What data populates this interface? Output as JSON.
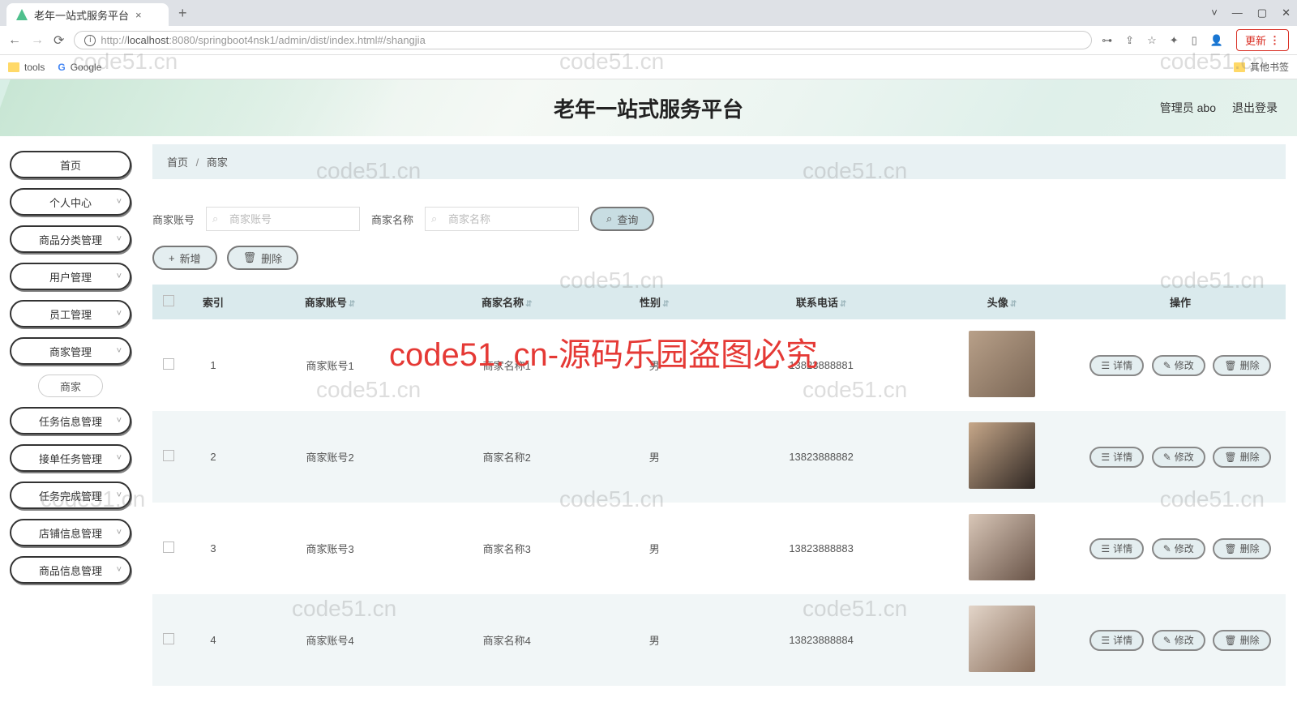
{
  "browser": {
    "tab_title": "老年一站式服务平台",
    "url_prefix": "http://",
    "url_host": "localhost",
    "url_port": ":8080",
    "url_path": "/springboot4nsk1/admin/dist/index.html#/shangjia",
    "update_label": "更新",
    "bookmarks": {
      "tools": "tools",
      "google": "Google",
      "other": "其他书签"
    }
  },
  "banner": {
    "title": "老年一站式服务平台",
    "admin_label": "管理员 abo",
    "logout": "退出登录"
  },
  "sidebar": {
    "items": [
      {
        "label": "首页",
        "expandable": false
      },
      {
        "label": "个人中心",
        "expandable": true
      },
      {
        "label": "商品分类管理",
        "expandable": true
      },
      {
        "label": "用户管理",
        "expandable": true
      },
      {
        "label": "员工管理",
        "expandable": true
      },
      {
        "label": "商家管理",
        "expandable": true
      },
      {
        "label": "商家",
        "sub": true
      },
      {
        "label": "任务信息管理",
        "expandable": true
      },
      {
        "label": "接单任务管理",
        "expandable": true
      },
      {
        "label": "任务完成管理",
        "expandable": true
      },
      {
        "label": "店铺信息管理",
        "expandable": true
      },
      {
        "label": "商品信息管理",
        "expandable": true
      }
    ]
  },
  "breadcrumb": {
    "home": "首页",
    "current": "商家"
  },
  "filter": {
    "account_label": "商家账号",
    "account_placeholder": "商家账号",
    "name_label": "商家名称",
    "name_placeholder": "商家名称",
    "search_btn": "查询"
  },
  "toolbar": {
    "add": "新增",
    "delete": "删除"
  },
  "table": {
    "headers": {
      "index": "索引",
      "account": "商家账号",
      "name": "商家名称",
      "gender": "性别",
      "phone": "联系电话",
      "avatar": "头像",
      "ops": "操作"
    },
    "ops": {
      "detail": "详情",
      "edit": "修改",
      "delete": "删除"
    },
    "rows": [
      {
        "index": "1",
        "account": "商家账号1",
        "name": "商家名称1",
        "gender": "男",
        "phone": "13823888881"
      },
      {
        "index": "2",
        "account": "商家账号2",
        "name": "商家名称2",
        "gender": "男",
        "phone": "13823888882"
      },
      {
        "index": "3",
        "account": "商家账号3",
        "name": "商家名称3",
        "gender": "男",
        "phone": "13823888883"
      },
      {
        "index": "4",
        "account": "商家账号4",
        "name": "商家名称4",
        "gender": "男",
        "phone": "13823888884"
      }
    ]
  },
  "watermarks": {
    "text": "code51.cn",
    "red": "code51. cn-源码乐园盗图必究"
  }
}
